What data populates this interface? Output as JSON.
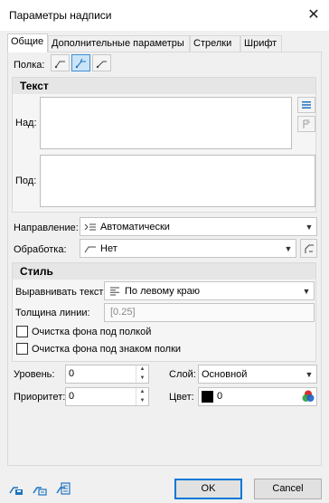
{
  "dialog": {
    "title": "Параметры надписи",
    "close_glyph": "✕"
  },
  "tabs": [
    {
      "label": "Общие",
      "active": true
    },
    {
      "label": "Дополнительные параметры",
      "active": false
    },
    {
      "label": "Стрелки",
      "active": false
    },
    {
      "label": "Шрифт",
      "active": false
    }
  ],
  "shelf": {
    "label": "Полка:",
    "options": [
      {
        "icon": "shelf-left-icon",
        "selected": false
      },
      {
        "icon": "shelf-center-icon",
        "selected": true
      },
      {
        "icon": "shelf-right-icon",
        "selected": false
      }
    ]
  },
  "text_group": {
    "title": "Текст",
    "above_label": "Над:",
    "below_label": "Под:",
    "above_value": "",
    "below_value": ""
  },
  "direction": {
    "label": "Направление:",
    "value": "Автоматически",
    "icon": "auto-direction-icon"
  },
  "processing": {
    "label": "Обработка:",
    "value": "Нет",
    "icon": "line-icon"
  },
  "style_group": {
    "title": "Стиль",
    "align_label": "Выравнивать текст:",
    "align_value": "По левому краю",
    "line_width_label": "Толщина линии:",
    "line_width_value": "[0.25]",
    "clear_bg_shelf_label": "Очистка фона под полкой",
    "clear_bg_sign_label": "Очистка фона под знаком полки",
    "clear_bg_shelf_checked": false,
    "clear_bg_sign_checked": false
  },
  "level": {
    "label": "Уровень:",
    "value": "0"
  },
  "priority": {
    "label": "Приоритет:",
    "value": "0"
  },
  "layer": {
    "label": "Слой:",
    "value": "Основной"
  },
  "color": {
    "label": "Цвет:",
    "value": "0",
    "swatch": "#000000"
  },
  "buttons": {
    "ok": "OK",
    "cancel": "Cancel"
  },
  "colors": {
    "accent": "#0078d7",
    "selected_bg": "#cce4f7",
    "icon_blue": "#1e73be"
  }
}
